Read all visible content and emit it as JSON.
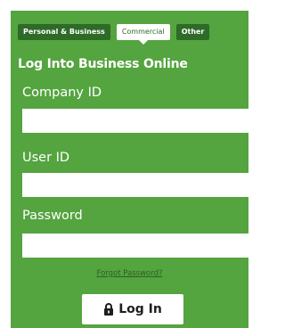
{
  "tabs": [
    {
      "label": "Personal & Business"
    },
    {
      "label": "Commercial"
    },
    {
      "label": "Other"
    }
  ],
  "title": "Log Into Business Online",
  "fields": {
    "company_id": {
      "label": "Company ID",
      "value": "",
      "placeholder": ""
    },
    "user_id": {
      "label": "User ID",
      "value": "",
      "placeholder": ""
    },
    "password": {
      "label": "Password",
      "value": "",
      "placeholder": ""
    }
  },
  "forgot_password": "Forgot Password?",
  "login_button": {
    "label": "Log In",
    "icon": "lock-icon"
  },
  "colors": {
    "panel_green": "#54a43f",
    "tab_dark_green": "#2e6a28",
    "link_dark_green": "#2c5f24"
  }
}
